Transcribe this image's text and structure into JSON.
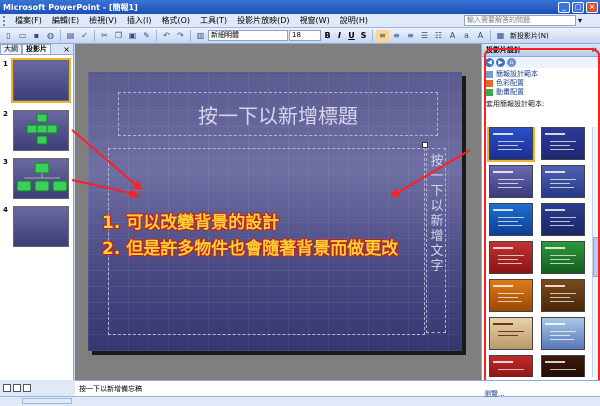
{
  "window": {
    "title": "Microsoft PowerPoint - [簡報1]",
    "buttons": [
      "_",
      "□",
      "×"
    ]
  },
  "menu": {
    "items": [
      "檔案(F)",
      "編輯(E)",
      "檢視(V)",
      "插入(I)",
      "格式(O)",
      "工具(T)",
      "投影片放映(D)",
      "視窗(W)",
      "說明(H)"
    ],
    "help_placeholder": "輸入需要解答的問題"
  },
  "toolbar": {
    "font_name": "新細明體",
    "font_size": "18",
    "bold": "B",
    "italic": "I",
    "underline": "U",
    "shadow": "S",
    "new_slide_label": "新投影片(N)"
  },
  "left_panel": {
    "tabs": [
      "大綱",
      "投影片"
    ],
    "slides": [
      "1",
      "2",
      "3",
      "4"
    ]
  },
  "slide": {
    "title_placeholder": "按一下以新增標題",
    "vertical_text": "按一下以新增文字"
  },
  "annotations": {
    "line1": "1. 可以改變背景的設計",
    "line2": "2. 但是許多物件也會隨著背景而做更改"
  },
  "task_pane": {
    "title": "投影片設計",
    "links": [
      "簡報設計範本",
      "色彩配置",
      "動畫配置"
    ],
    "section_label": "套用簡報設計範本:",
    "footer_link": "瀏覽..."
  },
  "notes": {
    "placeholder": "按一下以新增備忘稿"
  }
}
